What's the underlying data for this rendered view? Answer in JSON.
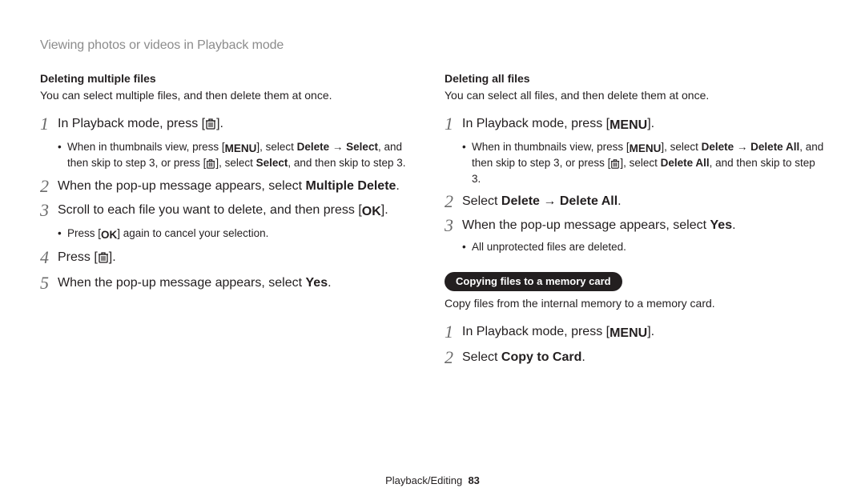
{
  "header": "Viewing photos or videos in Playback mode",
  "icons": {
    "trash": "trash-icon",
    "menu": "MENU",
    "ok": "OK"
  },
  "left": {
    "title": "Deleting multiple files",
    "desc": "You can select multiple files, and then delete them at once.",
    "step1_a": "In Playback mode, press [",
    "step1_b": "].",
    "step1_sub_a": "When in thumbnails view, press [",
    "step1_sub_b": "], select ",
    "step1_sub_bold1": "Delete",
    "step1_sub_arrow": " → ",
    "step1_sub_bold2": "Select",
    "step1_sub_c": ", and then skip to step 3, or press [",
    "step1_sub_d": "], select ",
    "step1_sub_bold3": "Select",
    "step1_sub_e": ", and then skip to step 3.",
    "step2_a": "When the pop-up message appears, select ",
    "step2_bold": "Multiple Delete",
    "step2_b": ".",
    "step3_a": "Scroll to each file you want to delete, and then press [",
    "step3_b": "].",
    "step3_sub_a": "Press [",
    "step3_sub_b": "] again to cancel your selection.",
    "step4_a": "Press [",
    "step4_b": "].",
    "step5_a": "When the pop-up message appears, select ",
    "step5_bold": "Yes",
    "step5_b": "."
  },
  "right": {
    "title": "Deleting all files",
    "desc": "You can select all files, and then delete them at once.",
    "step1_a": "In Playback mode, press [",
    "step1_b": "].",
    "step1_sub_a": "When in thumbnails view, press [",
    "step1_sub_b": "], select ",
    "step1_sub_bold1": "Delete",
    "step1_sub_arrow": " → ",
    "step1_sub_bold2": "Delete All",
    "step1_sub_c": ", and then skip to step 3, or press [",
    "step1_sub_d": "], select ",
    "step1_sub_bold3": "Delete All",
    "step1_sub_e": ", and then skip to step 3.",
    "step2_a": "Select ",
    "step2_bold1": "Delete",
    "step2_arrow": " → ",
    "step2_bold2": "Delete All",
    "step2_b": ".",
    "step3_a": "When the pop-up message appears, select ",
    "step3_bold": "Yes",
    "step3_b": ".",
    "step3_sub": "All unprotected files are deleted.",
    "pill": "Copying files to a memory card",
    "copy_desc": "Copy files from the internal memory to a memory card.",
    "copy_step1_a": "In Playback mode, press [",
    "copy_step1_b": "].",
    "copy_step2_a": "Select ",
    "copy_step2_bold": "Copy to Card",
    "copy_step2_b": "."
  },
  "footer": {
    "section": "Playback/Editing",
    "page": "83"
  }
}
